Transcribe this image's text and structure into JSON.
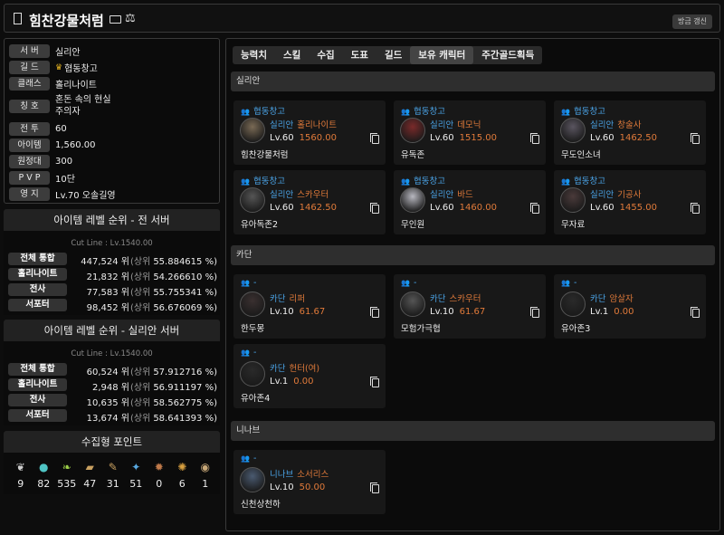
{
  "header": {
    "title": "힘찬강물처럼",
    "refresh_label": "방금 갱신"
  },
  "info": [
    {
      "label": "서 버",
      "value": "실리안"
    },
    {
      "label": "길 드",
      "value": "협동창고",
      "crown": true
    },
    {
      "label": "클래스",
      "value": "홀리나이트"
    },
    {
      "label": "칭 호",
      "value": "혼돈 속의 현실",
      "value2": "주의자"
    },
    {
      "label": "전 투",
      "value": "60"
    },
    {
      "label": "아이템",
      "value": "1,560.00"
    },
    {
      "label": "원정대",
      "value": "300"
    },
    {
      "label": "P V P",
      "value": "10단"
    },
    {
      "label": "영 지",
      "value": "Lv.70 오솔길영"
    }
  ],
  "rank_all": {
    "title": "아이템 레벨 순위 - 전 서버",
    "cut_line": "Cut Line : Lv.1540.00",
    "rows": [
      {
        "label": "전체 통합",
        "rank": "447,524 위",
        "percent": "55.884615 %)"
      },
      {
        "label": "홀리나이트",
        "rank": "21,832 위",
        "percent": "54.266610 %)"
      },
      {
        "label": "전사",
        "rank": "77,583 위",
        "percent": "55.755341 %)"
      },
      {
        "label": "서포터",
        "rank": "98,452 위",
        "percent": "56.676069 %)"
      }
    ]
  },
  "rank_server": {
    "title": "아이템 레벨 순위 - 실리안 서버",
    "cut_line": "Cut Line : Lv.1540.00",
    "rows": [
      {
        "label": "전체 통합",
        "rank": "60,524 위",
        "percent": "57.912716 %)"
      },
      {
        "label": "홀리나이트",
        "rank": "2,948 위",
        "percent": "56.911197 %)"
      },
      {
        "label": "전사",
        "rank": "10,635 위",
        "percent": "58.562775 %)"
      },
      {
        "label": "서포터",
        "rank": "13,674 위",
        "percent": "58.641393 %)"
      }
    ]
  },
  "rank_prefix": "(상위",
  "collect": {
    "title": "수집형 포인트",
    "items": [
      {
        "icon": "mokoko-seed-icon",
        "glyph": "❦",
        "color": "#cfcfcf",
        "count": "9"
      },
      {
        "icon": "island-heart-icon",
        "glyph": "●",
        "color": "#4fc4c4",
        "count": "82"
      },
      {
        "icon": "mokoko-sprout-icon",
        "glyph": "❧",
        "color": "#9ed14a",
        "count": "535"
      },
      {
        "icon": "masterpiece-icon",
        "glyph": "▰",
        "color": "#c8a060",
        "count": "47"
      },
      {
        "icon": "adventure-note-icon",
        "glyph": "✎",
        "color": "#c8a060",
        "count": "31"
      },
      {
        "icon": "ignea-token-icon",
        "glyph": "✦",
        "color": "#58a8e0",
        "count": "51"
      },
      {
        "icon": "orpheus-star-icon",
        "glyph": "✹",
        "color": "#c07a4a",
        "count": "0"
      },
      {
        "icon": "world-tree-leaf-icon",
        "glyph": "✺",
        "color": "#d8a040",
        "count": "6"
      },
      {
        "icon": "giants-heart-icon",
        "glyph": "◉",
        "color": "#c8a878",
        "count": "1"
      }
    ]
  },
  "tabs": [
    "능력치",
    "스킬",
    "수집",
    "도표",
    "길드",
    "보유 캐릭터",
    "주간골드획득"
  ],
  "active_tab": "보유 캐릭터",
  "servers": [
    {
      "name": "실리안",
      "chars": [
        {
          "guild": "협동창고",
          "server": "실리안",
          "class": "홀리나이트",
          "lv": "Lv.60",
          "ilvl": "1560.00",
          "name": "힘찬강물처럼",
          "avatar": "#7a6a55"
        },
        {
          "guild": "협동창고",
          "server": "실리안",
          "class": "데모닉",
          "lv": "Lv.60",
          "ilvl": "1515.00",
          "name": "유독존",
          "avatar": "#7a2a2a"
        },
        {
          "guild": "협동창고",
          "server": "실리안",
          "class": "창술사",
          "lv": "Lv.60",
          "ilvl": "1462.50",
          "name": "무도인소녀",
          "avatar": "#5a5560"
        },
        {
          "guild": "협동창고",
          "server": "실리안",
          "class": "스카우터",
          "lv": "Lv.60",
          "ilvl": "1462.50",
          "name": "유아독존2",
          "avatar": "#555"
        },
        {
          "guild": "협동창고",
          "server": "실리안",
          "class": "바드",
          "lv": "Lv.60",
          "ilvl": "1460.00",
          "name": "무인원",
          "avatar": "#b8b8c0"
        },
        {
          "guild": "협동창고",
          "server": "실리안",
          "class": "기공사",
          "lv": "Lv.60",
          "ilvl": "1455.00",
          "name": "무자료",
          "avatar": "#4a3a3a"
        }
      ]
    },
    {
      "name": "카단",
      "chars": [
        {
          "guild": "-",
          "server": "카단",
          "class": "리퍼",
          "lv": "Lv.10",
          "ilvl": "61.67",
          "name": "한두몽",
          "avatar": "#3a3030"
        },
        {
          "guild": "-",
          "server": "카단",
          "class": "스카우터",
          "lv": "Lv.10",
          "ilvl": "61.67",
          "name": "모험가극협",
          "avatar": "#555"
        },
        {
          "guild": "-",
          "server": "카단",
          "class": "암살자",
          "lv": "Lv.1",
          "ilvl": "0.00",
          "name": "유아존3",
          "avatar": "#2a2a2a"
        },
        {
          "guild": "-",
          "server": "카단",
          "class": "헌터(여)",
          "lv": "Lv.1",
          "ilvl": "0.00",
          "name": "유아존4",
          "avatar": "#2a2a2a"
        }
      ]
    },
    {
      "name": "니나브",
      "chars": [
        {
          "guild": "-",
          "server": "니나브",
          "class": "소서리스",
          "lv": "Lv.10",
          "ilvl": "50.00",
          "name": "신천상천하",
          "avatar": "#4a5a70"
        }
      ]
    }
  ]
}
